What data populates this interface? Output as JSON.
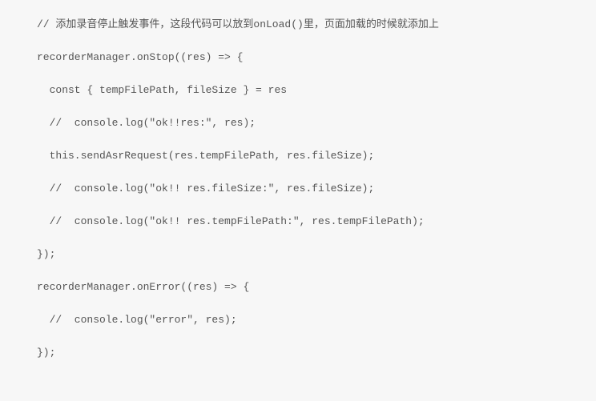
{
  "code": {
    "lines": [
      "// 添加录音停止触发事件，这段代码可以放到onLoad()里，页面加载的时候就添加上",
      "",
      "recorderManager.onStop((res) => {",
      "",
      "  const { tempFilePath, fileSize } = res",
      "",
      "  //  console.log(\"ok!!res:\", res);",
      "",
      "  this.sendAsrRequest(res.tempFilePath, res.fileSize);",
      "",
      "  //  console.log(\"ok!! res.fileSize:\", res.fileSize);",
      "",
      "  //  console.log(\"ok!! res.tempFilePath:\", res.tempFilePath);",
      "",
      "});",
      "",
      "recorderManager.onError((res) => {",
      "",
      "  //  console.log(\"error\", res);",
      "",
      "});"
    ]
  }
}
